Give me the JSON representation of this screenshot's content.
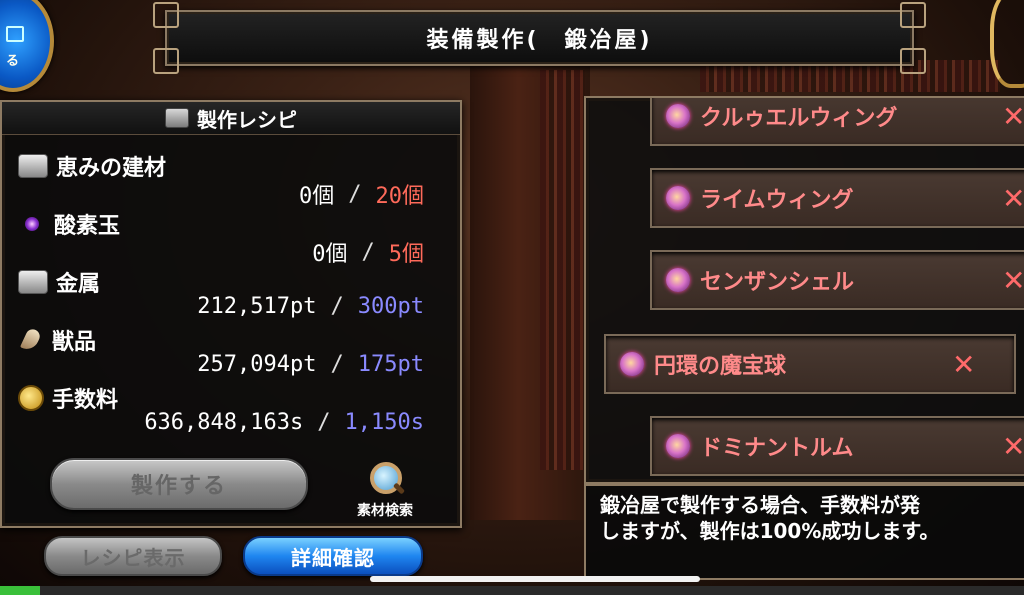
{
  "screen": {
    "title": "装備製作(　鍛冶屋)"
  },
  "menu_orb": {
    "label": "る"
  },
  "recipe": {
    "header": "製作レシピ",
    "materials": [
      {
        "name": "恵みの建材",
        "icon": "building-material-icon",
        "have": "0個",
        "sep": "/",
        "need": "20個",
        "need_color": "red"
      },
      {
        "name": "酸素玉",
        "icon": "oxygen-orb-icon",
        "have": "0個",
        "sep": "/",
        "need": "5個",
        "need_color": "red"
      },
      {
        "name": "金属",
        "icon": "metal-icon",
        "have": "212,517pt",
        "sep": "/",
        "need": "300pt",
        "need_color": "blue"
      },
      {
        "name": "獣品",
        "icon": "fang-icon",
        "have": "257,094pt",
        "sep": "/",
        "need": "175pt",
        "need_color": "blue"
      },
      {
        "name": "手数料",
        "icon": "coins-icon",
        "have": "636,848,163s",
        "sep": "/",
        "need": "1,150s",
        "need_color": "blue"
      }
    ],
    "craft_button": "製作する",
    "search_label": "素材検索"
  },
  "bottom_buttons": {
    "recipe_display": "レシピ表示",
    "detail_confirm": "詳細確認"
  },
  "item_list": [
    {
      "label": "クルゥエルウィング"
    },
    {
      "label": "ライムウィング"
    },
    {
      "label": "センザンシェル"
    },
    {
      "label": "円環の魔宝球"
    },
    {
      "label": "ドミナントルム"
    }
  ],
  "remove_glyph": "✕",
  "info": {
    "line1": "鍛冶屋で製作する場合、手数料が発",
    "line2": "しますが、製作は100%成功します。"
  },
  "colors": {
    "need_red": "#ff6a5a",
    "need_blue": "#8a8aff",
    "item_label": "#ff8a8a",
    "primary_button": "#1f86f0"
  }
}
